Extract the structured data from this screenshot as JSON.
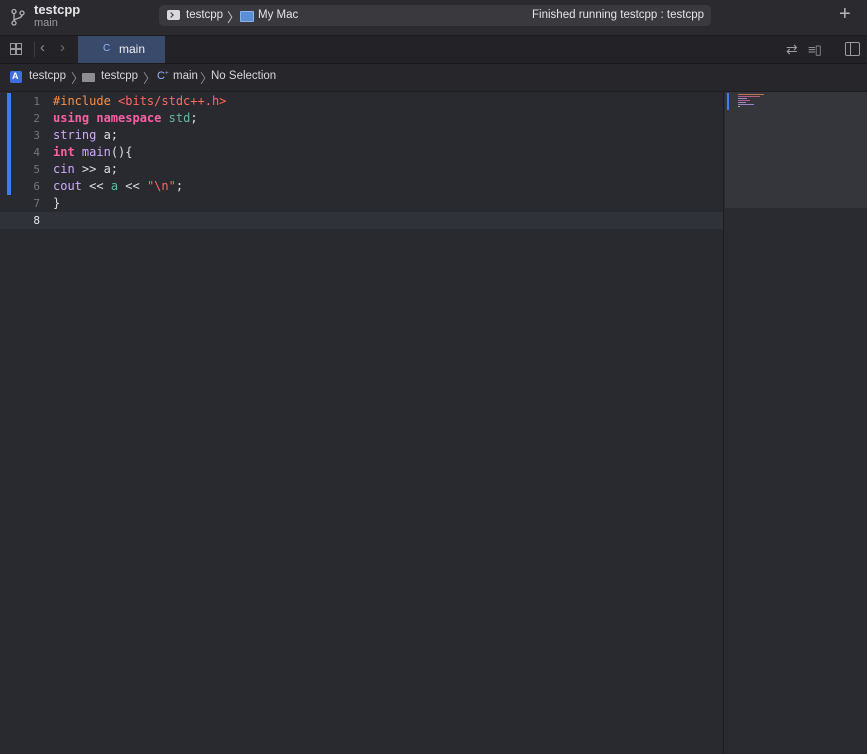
{
  "titlebar": {
    "project_name": "testcpp",
    "branch": "main",
    "scheme": "testcpp",
    "destination": "My Mac",
    "status": "Finished running testcpp : testcpp",
    "add_icon": "plus-icon",
    "branch_icon": "source-control-branch-icon"
  },
  "tabbar": {
    "active_tab": "main",
    "tab_icon": "c-source-file-icon"
  },
  "jumpbar": {
    "project": "testcpp",
    "folder": "testcpp",
    "file": "main",
    "selection": "No Selection"
  },
  "editor": {
    "current_line": 8,
    "lines": [
      {
        "num": "1"
      },
      {
        "num": "2"
      },
      {
        "num": "3"
      },
      {
        "num": "4"
      },
      {
        "num": "5"
      },
      {
        "num": "6"
      },
      {
        "num": "7"
      },
      {
        "num": "8"
      }
    ],
    "code": {
      "l1_pp": "#include ",
      "l1_hdr": "<bits/stdc++.h>",
      "l2_kw1": "using",
      "l2_sp1": " ",
      "l2_kw2": "namespace",
      "l2_sp2": " ",
      "l2_id": "std",
      "l2_end": ";",
      "l3_type": "string",
      "l3_rest": " a;",
      "l4_kw": "int",
      "l4_sp": " ",
      "l4_fn": "main",
      "l4_rest": "(){",
      "l5_id": "cin",
      "l5_rest": " >> a;",
      "l6_id": "cout",
      "l6_mid1": " << ",
      "l6_a": "a",
      "l6_mid2": " << ",
      "l6_str": "\"\\n\"",
      "l6_end": ";",
      "l7": "}"
    }
  },
  "colors": {
    "background": "#292a30",
    "keyword": "#fc5fa3",
    "preprocessor": "#fd8f3f",
    "string": "#fc6a5d",
    "change_bar": "#3e7cf6",
    "active_tab": "#3a4a6a"
  }
}
